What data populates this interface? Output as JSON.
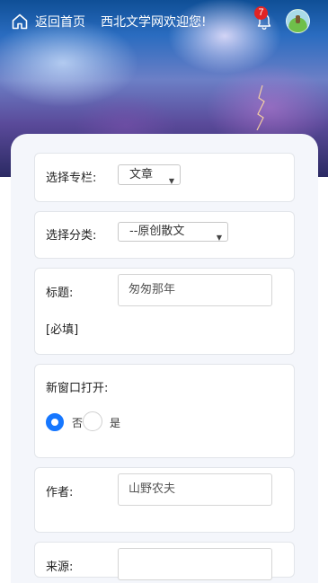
{
  "header": {
    "home_label": "返回首页",
    "welcome": "西北文学网欢迎您!",
    "notification_count": "7"
  },
  "form": {
    "column": {
      "label": "选择专栏:",
      "value": "文章"
    },
    "category": {
      "label": "选择分类:",
      "value": "--原创散文"
    },
    "title": {
      "label": "标题:",
      "value": "匆匆那年",
      "required": "[必填]"
    },
    "new_window": {
      "label": "新窗口打开:",
      "option_no": "否",
      "option_yes": "是",
      "selected": "否"
    },
    "author": {
      "label": "作者:",
      "value": "山野农夫"
    },
    "source": {
      "label": "来源:",
      "value": ""
    }
  },
  "colors": {
    "accent": "#1677ff",
    "badge": "#e02424"
  }
}
